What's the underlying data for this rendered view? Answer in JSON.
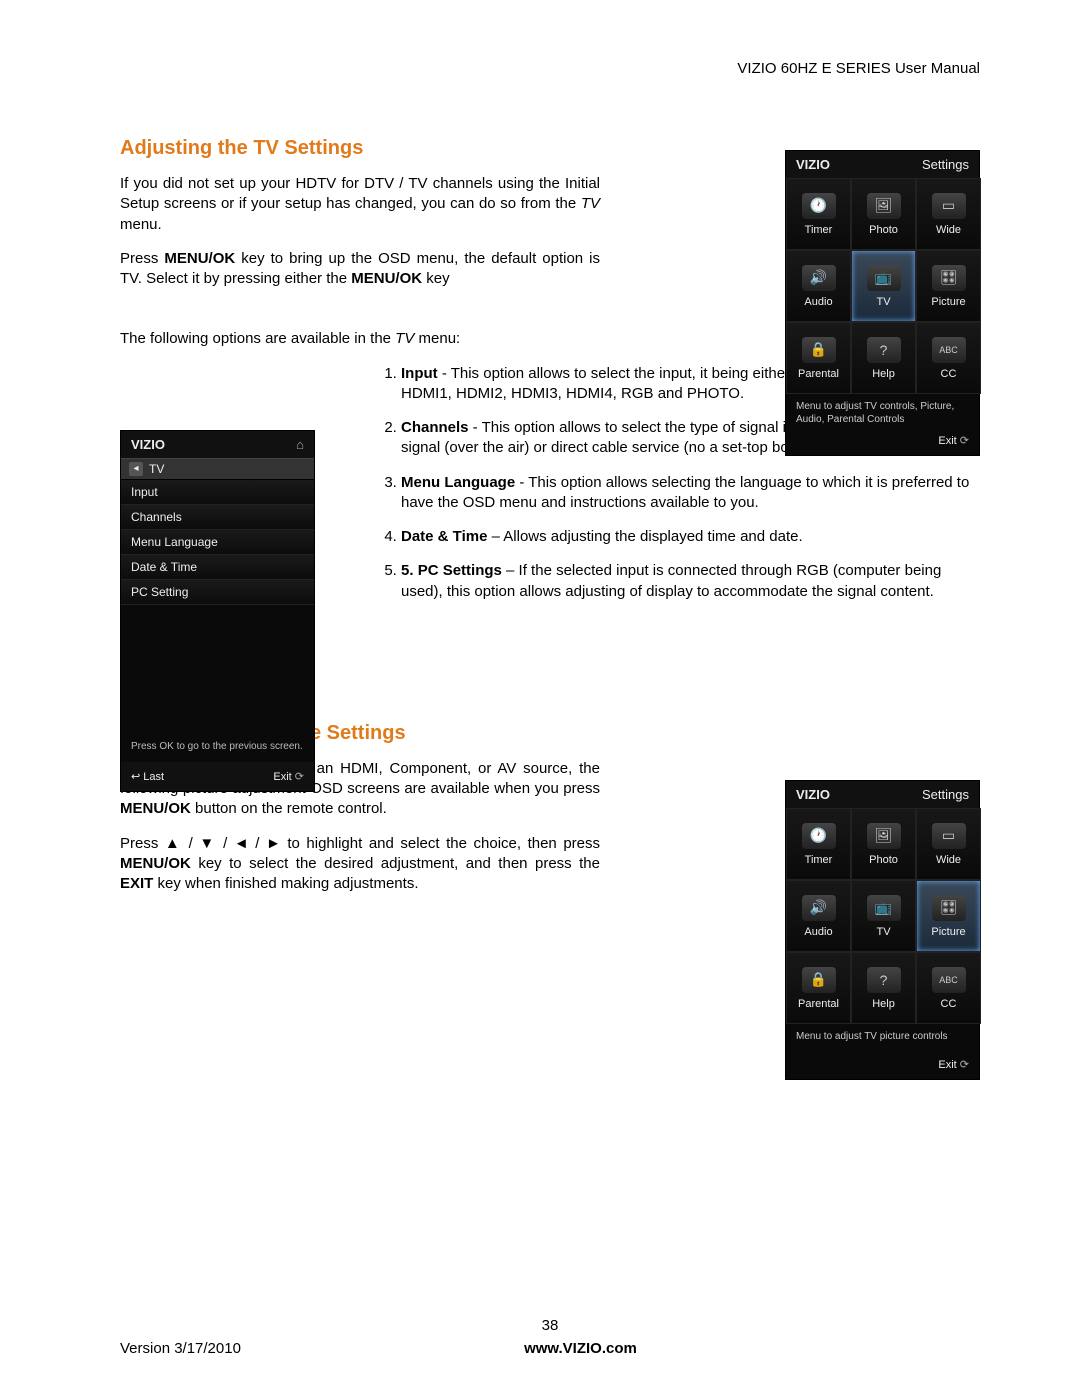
{
  "header": {
    "title": "VIZIO 60HZ E SERIES User Manual"
  },
  "section1": {
    "heading": "Adjusting the TV Settings",
    "p1a": "If you did not set up your HDTV for DTV / TV channels using the Initial Setup screens or if your setup has changed, you can do so from the ",
    "p1b": "TV",
    "p1c": " menu.",
    "p2a": "Press ",
    "p2b": "MENU/OK",
    "p2c": " key to bring up the OSD menu, the default option is TV. Select it by pressing either the ",
    "p2d": "MENU/OK",
    "p2e": " key",
    "p3a": "The following options are available in the ",
    "p3b": "TV",
    "p3c": " menu:",
    "opt1a": "Input",
    "opt1b": " -  This option allows to select the input, it being either DTV/TV, A/V, Component, HDMI1, HDMI2, HDMI3, HDMI4, RGB and PHOTO.",
    "opt2a": "Channels",
    "opt2b": " - This option allows to select the type of signal input, it being either antenna signal (over the air) or direct cable service (no a set-top box).",
    "opt3a": "Menu Language",
    "opt3b": " - This option allows selecting the language to which it is preferred to have the OSD menu and instructions available to you.",
    "opt4a": "Date & Time",
    "opt4b": " – Allows adjusting the displayed time and date.",
    "opt5a": "PC Settings",
    "opt5b": " – If the selected input is connected through RGB (computer being used), this option allows adjusting of display to accommodate the signal content."
  },
  "section2": {
    "heading": "Adjusting the Picture Settings",
    "p1a": "When viewing DTV / TV or an HDMI, Component, or AV source, the following picture adjustment OSD screens are available when you press ",
    "p1b": "MENU/OK",
    "p1c": " button on the remote control.",
    "p2a": "Press ▲ / ▼ / ◄ / ► to highlight and select the choice, then press ",
    "p2b": "MENU/OK",
    "p2c": " key to select the desired adjustment, and then press the ",
    "p2d": "EXIT",
    "p2e": " key when finished making adjustments."
  },
  "footer": {
    "page": "38",
    "version": "Version 3/17/2010",
    "url": "www.VIZIO.com"
  },
  "osd": {
    "brand": "VIZIO",
    "settings": "Settings",
    "cells": {
      "timer": "Timer",
      "photo": "Photo",
      "wide": "Wide",
      "audio": "Audio",
      "tv": "TV",
      "picture": "Picture",
      "parental": "Parental",
      "help": "Help",
      "cc": "CC"
    },
    "hint1": "Menu to adjust TV controls, Picture, Audio, Parental Controls",
    "hint2": "Menu to adjust TV picture controls",
    "exit": "Exit",
    "tvlist": {
      "crumb": "TV",
      "items": [
        "Input",
        "Channels",
        "Menu Language",
        "Date & Time",
        "PC Setting"
      ],
      "prompt": "Press OK to go to the previous screen.",
      "last": "Last",
      "exit": "Exit"
    }
  }
}
